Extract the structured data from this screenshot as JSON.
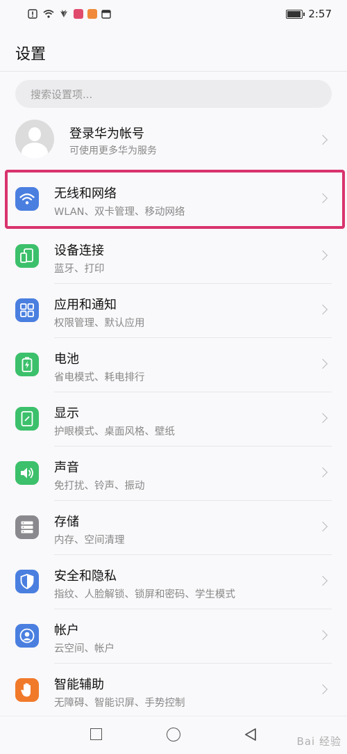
{
  "status_bar": {
    "time": "2:57",
    "battery_level": 0.85,
    "icons": [
      "alert-icon",
      "wifi-icon",
      "huawei-icon",
      "app-notification-icon",
      "app-notification-icon-2",
      "calendar-icon"
    ]
  },
  "page": {
    "title": "设置"
  },
  "search": {
    "placeholder": "搜索设置项..."
  },
  "account": {
    "title": "登录华为帐号",
    "subtitle": "可使用更多华为服务"
  },
  "settings": [
    {
      "label": "无线和网络",
      "sub": "WLAN、双卡管理、移动网络",
      "icon": "wifi-icon",
      "color": "#4a7fe0"
    },
    {
      "label": "设备连接",
      "sub": "蓝牙、打印",
      "icon": "device-connection-icon",
      "color": "#3cc06b"
    },
    {
      "label": "应用和通知",
      "sub": "权限管理、默认应用",
      "icon": "apps-grid-icon",
      "color": "#4a7fe0"
    },
    {
      "label": "电池",
      "sub": "省电模式、耗电排行",
      "icon": "battery-icon",
      "color": "#3cc06b"
    },
    {
      "label": "显示",
      "sub": "护眼模式、桌面风格、壁纸",
      "icon": "display-icon",
      "color": "#3cc06b"
    },
    {
      "label": "声音",
      "sub": "免打扰、铃声、振动",
      "icon": "sound-icon",
      "color": "#3cc06b"
    },
    {
      "label": "存储",
      "sub": "内存、空间清理",
      "icon": "storage-icon",
      "color": "#8a8a8e"
    },
    {
      "label": "安全和隐私",
      "sub": "指纹、人脸解锁、锁屏和密码、学生模式",
      "icon": "shield-icon",
      "color": "#4a7fe0"
    },
    {
      "label": "帐户",
      "sub": "云空间、帐户",
      "icon": "account-icon",
      "color": "#4a7fe0"
    },
    {
      "label": "智能辅助",
      "sub": "无障碍、智能识屏、手势控制",
      "icon": "hand-icon",
      "color": "#f07a2a"
    }
  ],
  "highlight_color": "#d8336d",
  "watermark": "Bai 经验"
}
